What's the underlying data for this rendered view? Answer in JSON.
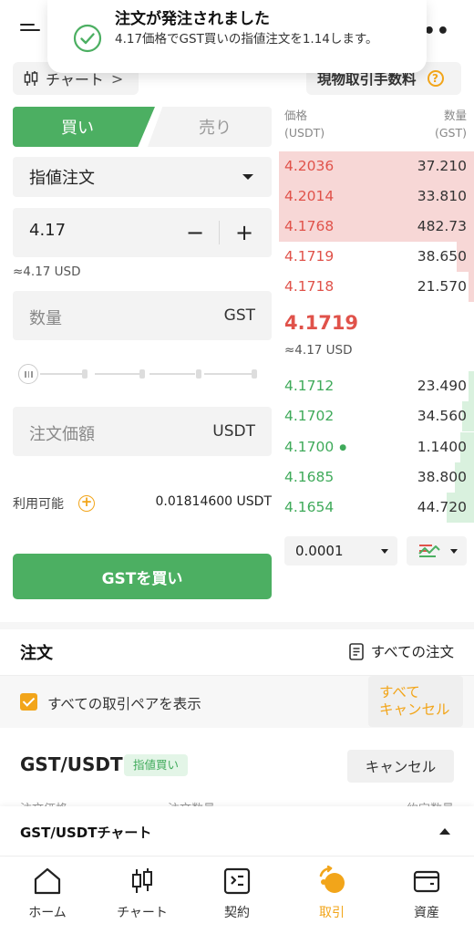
{
  "toast": {
    "title": "注文が発注されました",
    "message": "4.17価格でGST買いの指値注文を1.14します。"
  },
  "toolbar": {
    "chart_label": "チャート",
    "fee_label": "現物取引手数料"
  },
  "trade_form": {
    "buy_tab": "買い",
    "sell_tab": "売り",
    "order_type": "指値注文",
    "price_value": "4.17",
    "price_usd": "≈4.17 USD",
    "minus": "−",
    "plus": "+",
    "quantity_placeholder": "数量",
    "quantity_unit": "GST",
    "amount_placeholder": "注文価額",
    "amount_unit": "USDT",
    "available_label": "利用可能",
    "available_value": "0.01814600 USDT",
    "submit_label": "GSTを買い"
  },
  "order_book": {
    "price_header": [
      "価格",
      "(USDT)"
    ],
    "qty_header": [
      "数量",
      "(GST)"
    ],
    "asks": [
      {
        "price": "4.2036",
        "qty": "37.210",
        "depth": 1.0
      },
      {
        "price": "4.2014",
        "qty": "33.810",
        "depth": 1.0
      },
      {
        "price": "4.1768",
        "qty": "482.73",
        "depth": 1.0
      },
      {
        "price": "4.1719",
        "qty": "38.650",
        "depth": 0.09
      },
      {
        "price": "4.1718",
        "qty": "21.570",
        "depth": 0.03
      }
    ],
    "mid_price": "4.1719",
    "mid_usd": "≈4.17 USD",
    "bids": [
      {
        "price": "4.1712",
        "qty": "23.490",
        "depth": 0.03,
        "mine": false
      },
      {
        "price": "4.1702",
        "qty": "34.560",
        "depth": 0.06,
        "mine": false
      },
      {
        "price": "4.1700",
        "qty": "1.1400",
        "depth": 0.07,
        "mine": true
      },
      {
        "price": "4.1685",
        "qty": "38.800",
        "depth": 0.1,
        "mine": false
      },
      {
        "price": "4.1654",
        "qty": "44.720",
        "depth": 0.14,
        "mine": false
      }
    ],
    "precision": "0.0001"
  },
  "orders": {
    "title": "注文",
    "all_orders": "すべての注文",
    "show_all_pairs": "すべての取引ペアを表示",
    "cancel_all_line1": "すべて",
    "cancel_all_line2": "キャンセル",
    "pair": "GST/USDT",
    "tag": "指値買い",
    "cancel": "キャンセル",
    "col_price": "注文価格",
    "col_qty": "注文数量",
    "col_filled": "約定数量"
  },
  "chart_bar": {
    "label": "GST/USDTチャート"
  },
  "bottom_nav": [
    {
      "label": "ホーム",
      "icon": "home-icon"
    },
    {
      "label": "チャート",
      "icon": "candlestick-icon"
    },
    {
      "label": "契約",
      "icon": "contract-icon"
    },
    {
      "label": "取引",
      "icon": "trade-icon"
    },
    {
      "label": "資産",
      "icon": "wallet-icon"
    }
  ],
  "colors": {
    "buy_green": "#4caf62",
    "sell_red": "#e0524a",
    "accent_orange": "#f2a51a"
  }
}
